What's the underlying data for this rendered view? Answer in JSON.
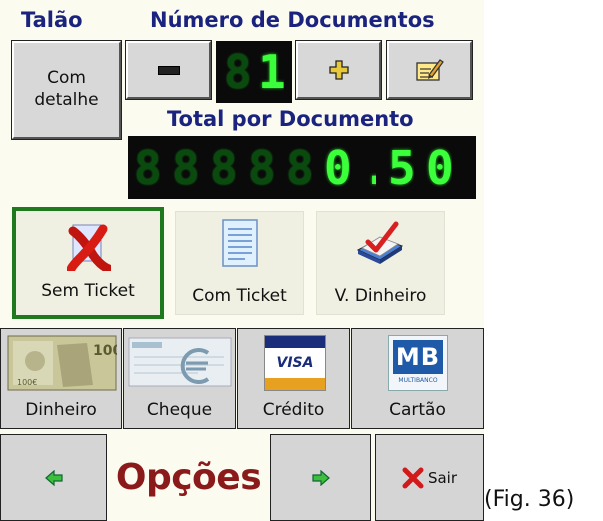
{
  "header": {
    "talao_label": "Talão",
    "num_docs_label": "Número de Documentos",
    "total_label": "Total por Documento"
  },
  "talao_button": {
    "label_line1": "Com",
    "label_line2": "detalhe"
  },
  "doc_counter": {
    "minus": "−",
    "plus": "+",
    "count_dim": "8",
    "count_lit": "1"
  },
  "total_display": {
    "dim_digits": [
      "8",
      "8",
      "8",
      "8",
      "8"
    ],
    "lit_digits": [
      "0",
      ".",
      "5",
      "0"
    ]
  },
  "ticket_options": [
    {
      "label": "Sem Ticket",
      "icon": "red-x-icon",
      "selected": true
    },
    {
      "label": "Com Ticket",
      "icon": "document-icon",
      "selected": false
    },
    {
      "label": "V. Dinheiro",
      "icon": "checkmark-book-icon",
      "selected": false
    }
  ],
  "payment_methods": [
    {
      "label": "Dinheiro",
      "icon": "banknote-icon"
    },
    {
      "label": "Cheque",
      "icon": "cheque-icon"
    },
    {
      "label": "Crédito",
      "icon": "visa-card-icon",
      "logo_text": "VISA"
    },
    {
      "label": "Cartão",
      "icon": "multibanco-icon",
      "logo_text": "MB",
      "logo_sub": "MULTIBANCO"
    }
  ],
  "nav": {
    "prev_icon": "arrow-left-icon",
    "next_icon": "arrow-right-icon",
    "title": "Opções",
    "exit_label": "Sair"
  },
  "caption": "(Fig. 36)",
  "colors": {
    "header_blue": "#1a237e",
    "led_green": "#3bff3b",
    "selected_border": "#1f7a1f",
    "title_red": "#8b1a1a"
  }
}
